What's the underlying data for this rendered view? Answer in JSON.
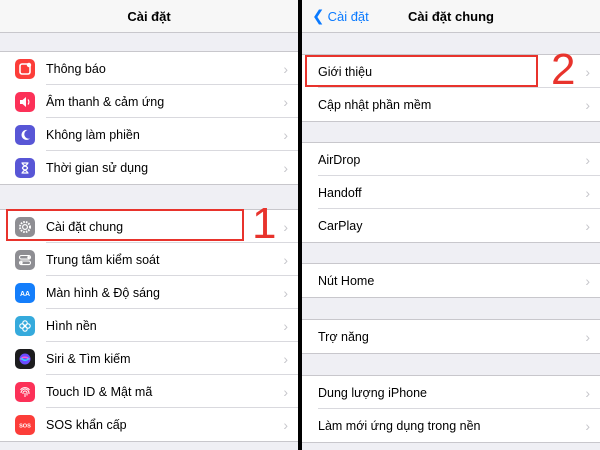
{
  "left": {
    "title": "Cài đặt",
    "groups": [
      [
        {
          "label": "Thông báo",
          "icon": "notification-icon",
          "color": "#fc3d39"
        },
        {
          "label": "Âm thanh & cảm ứng",
          "icon": "speaker-icon",
          "color": "#fc3158"
        },
        {
          "label": "Không làm phiền",
          "icon": "moon-icon",
          "color": "#5856d6"
        },
        {
          "label": "Thời gian sử dụng",
          "icon": "hourglass-icon",
          "color": "#5856d6"
        }
      ],
      [
        {
          "label": "Cài đặt chung",
          "icon": "gear-icon",
          "color": "#8e8e93"
        },
        {
          "label": "Trung tâm kiểm soát",
          "icon": "toggles-icon",
          "color": "#8e8e93"
        },
        {
          "label": "Màn hình & Độ sáng",
          "icon": "display-icon",
          "color": "#147efb"
        },
        {
          "label": "Hình nền",
          "icon": "flower-icon",
          "color": "#35aadc"
        },
        {
          "label": "Siri & Tìm kiếm",
          "icon": "siri-icon",
          "color": "#1c1c1e"
        },
        {
          "label": "Touch ID & Mật mã",
          "icon": "fingerprint-icon",
          "color": "#fc3158"
        },
        {
          "label": "SOS khẩn cấp",
          "icon": "sos-icon",
          "color": "#fc3d39"
        }
      ]
    ],
    "icon_texts": {
      "display": "AA",
      "sos": "SOS"
    },
    "step_number": "1"
  },
  "right": {
    "title": "Cài đặt chung",
    "back_label": "Cài đặt",
    "groups": [
      [
        "Giới thiệu",
        "Cập nhật phần mềm"
      ],
      [
        "AirDrop",
        "Handoff",
        "CarPlay"
      ],
      [
        "Nút Home"
      ],
      [
        "Trợ năng"
      ],
      [
        "Dung lượng iPhone",
        "Làm mới ứng dụng trong nền"
      ]
    ],
    "step_number": "2"
  },
  "colors": {
    "highlight": "#e8332c",
    "accent": "#0a7aff"
  }
}
